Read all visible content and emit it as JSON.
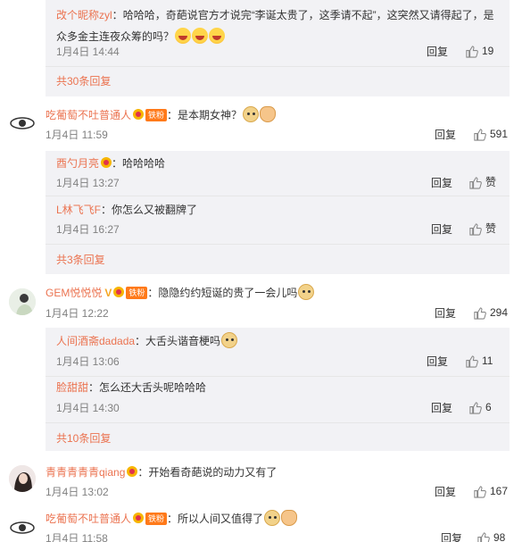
{
  "comments": [
    {
      "user": "改个昵称zyl",
      "text": "哈哈哈，奇葩说官方才说完“李诞太贵了，这季请不起”，这突然又请得起了，是众多金主连夜众筹的吗？",
      "date": "1月4日 14:44",
      "reply_label": "回复",
      "likes": "19",
      "emojis": [
        "laugh-emoji",
        "laugh-emoji",
        "laugh-emoji"
      ]
    }
  ],
  "thread1_more": "共30条回复",
  "c2": {
    "user": "吃葡萄不吐普通人",
    "badge": "铁粉",
    "text": "：是本期女神？",
    "date": "1月4日 11:59",
    "reply_label": "回复",
    "likes": "591",
    "replies": [
      {
        "user": "酉勺月亮",
        "text": "：哈哈哈哈",
        "date": "1月4日 13:27",
        "reply_label": "回复",
        "likes": "赞"
      },
      {
        "user": "L林飞飞F",
        "text": "：你怎么又被翻牌了",
        "date": "1月4日 16:27",
        "reply_label": "回复",
        "likes": "赞"
      }
    ],
    "more": "共3条回复"
  },
  "c3": {
    "user": "GEM悦悦悦",
    "badge": "铁粉",
    "text": "：隐隐约约短诞的贵了一会儿吗",
    "date": "1月4日 12:22",
    "reply_label": "回复",
    "likes": "294",
    "replies": [
      {
        "user": "人间酒斋dadada",
        "text": "：大舌头谐音梗吗",
        "date": "1月4日 13:06",
        "reply_label": "回复",
        "likes": "11"
      },
      {
        "user": "脸甜甜",
        "text": "：怎么还大舌头呢哈哈哈",
        "date": "1月4日 14:30",
        "reply_label": "回复",
        "likes": "6"
      }
    ],
    "more": "共10条回复"
  },
  "c4": {
    "user": "青青青青青qiang",
    "text": "：开始看奇葩说的动力又有了",
    "date": "1月4日 13:02",
    "reply_label": "回复",
    "likes": "167"
  },
  "c5": {
    "user": "吃葡萄不吐普通人",
    "badge": "铁粉",
    "text": "：所以人间又值得了",
    "date": "1月4日 11:58",
    "reply_label": "回复",
    "likes": "98"
  },
  "colors": {
    "name": "#eb7350",
    "reply_bg": "#f2f2f5",
    "meta": "#808080"
  }
}
